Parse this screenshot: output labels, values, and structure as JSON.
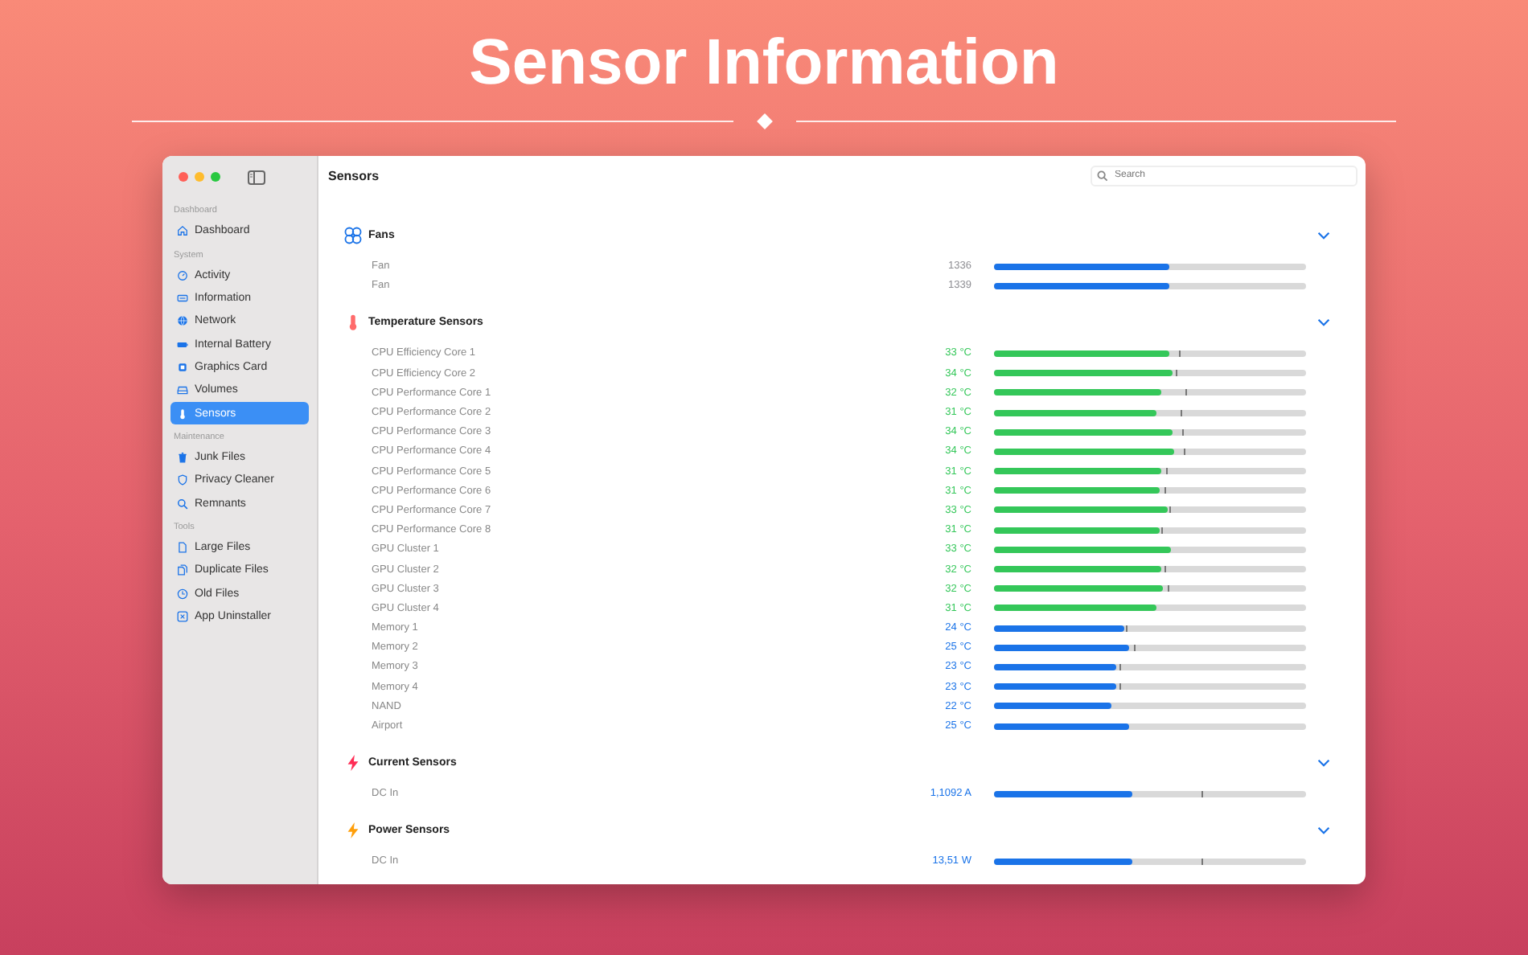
{
  "headline": "Sensor Information",
  "window": {
    "title": "Sensors",
    "search": {
      "placeholder": "Search"
    }
  },
  "sidebar": {
    "groups": [
      {
        "title": "Dashboard",
        "items": [
          {
            "label": "Dashboard",
            "kind": "house",
            "selected": false
          }
        ]
      },
      {
        "title": "System",
        "items": [
          {
            "label": "Activity",
            "kind": "gauge",
            "selected": false
          },
          {
            "label": "Information",
            "kind": "card",
            "selected": false
          },
          {
            "label": "Network",
            "kind": "globe",
            "selected": false
          },
          {
            "label": "Internal Battery",
            "kind": "battery",
            "selected": false
          },
          {
            "label": "Graphics Card",
            "kind": "chip",
            "selected": false
          },
          {
            "label": "Volumes",
            "kind": "drive",
            "selected": false
          },
          {
            "label": "Sensors",
            "kind": "thermo",
            "selected": true
          }
        ]
      },
      {
        "title": "Maintenance",
        "items": [
          {
            "label": "Junk Files",
            "kind": "trash",
            "selected": false
          },
          {
            "label": "Privacy Cleaner",
            "kind": "shield",
            "selected": false
          },
          {
            "label": "Remnants",
            "kind": "search",
            "selected": false
          }
        ]
      },
      {
        "title": "Tools",
        "items": [
          {
            "label": "Large Files",
            "kind": "doc",
            "selected": false
          },
          {
            "label": "Duplicate Files",
            "kind": "docs",
            "selected": false
          },
          {
            "label": "Old Files",
            "kind": "clock",
            "selected": false
          },
          {
            "label": "App Uninstaller",
            "kind": "xbox",
            "selected": false
          }
        ]
      }
    ]
  },
  "sections": [
    {
      "title": "Fans",
      "kind": "fan",
      "expanded": true,
      "rows": [
        {
          "name": "Fan",
          "reading": "1336",
          "color": "#8e8e93",
          "level": 0.56
        },
        {
          "name": "Fan",
          "reading": "1339",
          "color": "#8e8e93",
          "level": 0.56
        }
      ]
    },
    {
      "title": "Temperature Sensors",
      "kind": "thermo",
      "expanded": true,
      "rows": [
        {
          "name": "CPU Efficiency Core 1",
          "reading": "33 °C",
          "color": "#34c759",
          "level": 0.56,
          "peak": {
            "level": 0.595
          }
        },
        {
          "name": "CPU Efficiency Core 2",
          "reading": "34 °C",
          "color": "#34c759",
          "level": 0.572,
          "peak": {
            "level": 0.582
          }
        },
        {
          "name": "CPU Performance Core 1",
          "reading": "32 °C",
          "color": "#34c759",
          "level": 0.538,
          "peak": {
            "level": 0.613
          }
        },
        {
          "name": "CPU Performance Core 2",
          "reading": "31 °C",
          "color": "#34c759",
          "level": 0.52,
          "peak": {
            "level": 0.6
          }
        },
        {
          "name": "CPU Performance Core 3",
          "reading": "34 °C",
          "color": "#34c759",
          "level": 0.572,
          "peak": {
            "level": 0.605
          }
        },
        {
          "name": "CPU Performance Core 4",
          "reading": "34 °C",
          "color": "#34c759",
          "level": 0.579,
          "peak": {
            "level": 0.61
          }
        },
        {
          "name": "CPU Performance Core 5",
          "reading": "31 °C",
          "color": "#34c759",
          "level": 0.534,
          "peak": {
            "level": 0.552
          }
        },
        {
          "name": "CPU Performance Core 6",
          "reading": "31 °C",
          "color": "#34c759",
          "level": 0.533,
          "peak": {
            "level": 0.548
          }
        },
        {
          "name": "CPU Performance Core 7",
          "reading": "33 °C",
          "color": "#34c759",
          "level": 0.555,
          "peak": {
            "level": 0.564
          }
        },
        {
          "name": "CPU Performance Core 8",
          "reading": "31 °C",
          "color": "#34c759",
          "level": 0.529,
          "peak": {
            "level": 0.536
          }
        },
        {
          "name": "GPU Cluster 1",
          "reading": "33 °C",
          "color": "#34c759",
          "level": 0.567
        },
        {
          "name": "GPU Cluster 2",
          "reading": "32 °C",
          "color": "#34c759",
          "level": 0.538,
          "peak": {
            "level": 0.545
          }
        },
        {
          "name": "GPU Cluster 3",
          "reading": "32 °C",
          "color": "#34c759",
          "level": 0.543,
          "peak": {
            "level": 0.555
          }
        },
        {
          "name": "GPU Cluster 4",
          "reading": "31 °C",
          "color": "#34c759",
          "level": 0.52
        },
        {
          "name": "Memory 1",
          "reading": "24 °C",
          "color": "#1a73e8",
          "level": 0.416,
          "peak": {
            "level": 0.423
          }
        },
        {
          "name": "Memory 2",
          "reading": "25 °C",
          "color": "#1a73e8",
          "level": 0.433,
          "peak": {
            "level": 0.447
          }
        },
        {
          "name": "Memory 3",
          "reading": "23 °C",
          "color": "#1a73e8",
          "level": 0.392,
          "peak": {
            "level": 0.404
          }
        },
        {
          "name": "Memory 4",
          "reading": "23 °C",
          "color": "#1a73e8",
          "level": 0.392,
          "peak": {
            "level": 0.404
          }
        },
        {
          "name": "NAND",
          "reading": "22 °C",
          "color": "#1a73e8",
          "level": 0.378
        },
        {
          "name": "Airport",
          "reading": "25 °C",
          "color": "#1a73e8",
          "level": 0.431
        }
      ]
    },
    {
      "title": "Current Sensors",
      "kind": "bolt-red",
      "expanded": true,
      "rows": [
        {
          "name": "DC In",
          "reading": "1,1092 A",
          "color": "#1a73e8",
          "level": 0.443,
          "peak": {
            "level": 0.663
          }
        }
      ]
    },
    {
      "title": "Power Sensors",
      "kind": "bolt-orange",
      "expanded": true,
      "rows": [
        {
          "name": "DC In",
          "reading": "13,51 W",
          "color": "#1a73e8",
          "level": 0.443,
          "peak": {
            "level": 0.663
          }
        }
      ]
    }
  ]
}
